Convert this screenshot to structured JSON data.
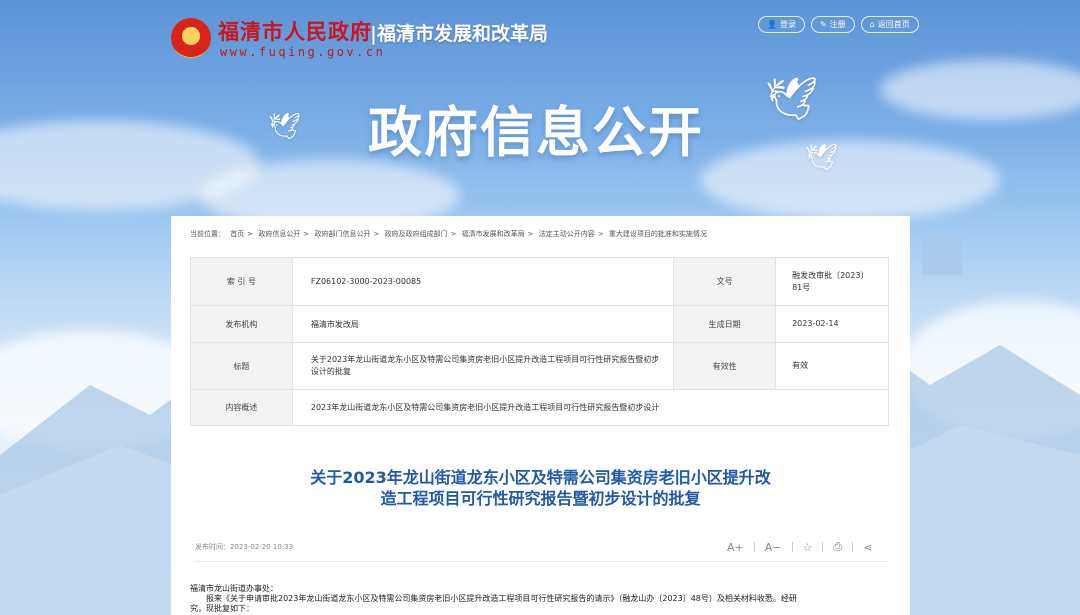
{
  "header": {
    "site_name": "福清市人民政府",
    "site_url": "www.fuqing.gov.cn",
    "dept_name": "|福清市发展和改革局",
    "links": [
      {
        "label": "登录",
        "icon": "user-icon"
      },
      {
        "label": "注册",
        "icon": "register-icon"
      },
      {
        "label": "返回首页",
        "icon": "home-icon"
      }
    ]
  },
  "banner": {
    "title": "政府信息公开"
  },
  "breadcrumb": {
    "prefix": "当前位置：",
    "items": [
      "首页",
      "政府信息公开",
      "政府部门信息公开",
      "政府及政府组成部门",
      "福清市发展和改革局",
      "法定主动公开内容",
      "重大建设项目的批准和实施情况"
    ],
    "separator": ">"
  },
  "meta": {
    "index_label": "索 引 号",
    "index_value": "FZ06102-3000-2023-00085",
    "docno_label": "文号",
    "docno_value": "融发改审批〔2023〕81号",
    "publisher_label": "发布机构",
    "publisher_value": "福清市发改局",
    "date_label": "生成日期",
    "date_value": "2023-02-14",
    "title_label": "标题",
    "title_value": "关于2023年龙山街道龙东小区及特需公司集资房老旧小区提升改造工程项目可行性研究报告暨初步设计的批复",
    "validity_label": "有效性",
    "validity_value": "有效",
    "summary_label": "内容概述",
    "summary_value": "2023年龙山街道龙东小区及特需公司集资房老旧小区提升改造工程项目可行性研究报告暨初步设计"
  },
  "article": {
    "title_line1": "关于2023年龙山街道龙东小区及特需公司集资房老旧小区提升改",
    "title_line2": "造工程项目可行性研究报告暨初步设计的批复",
    "publish_time": "发布时间：2023-02-20 10:33",
    "tools": {
      "font_up": "A+",
      "font_down": "A−"
    },
    "body_line1": "福清市龙山街道办事处：",
    "body_line2": "报来《关于申请审批2023年龙山街道龙东小区及特需公司集资房老旧小区提升改造工程项目可行性研究报告的请示》（融龙山办〔2023〕48号）及相关材料收悉。经研",
    "body_line3": "究，现批复如下："
  },
  "colors": {
    "brand_red": "#c8161d",
    "title_blue": "#1f5aa8"
  }
}
